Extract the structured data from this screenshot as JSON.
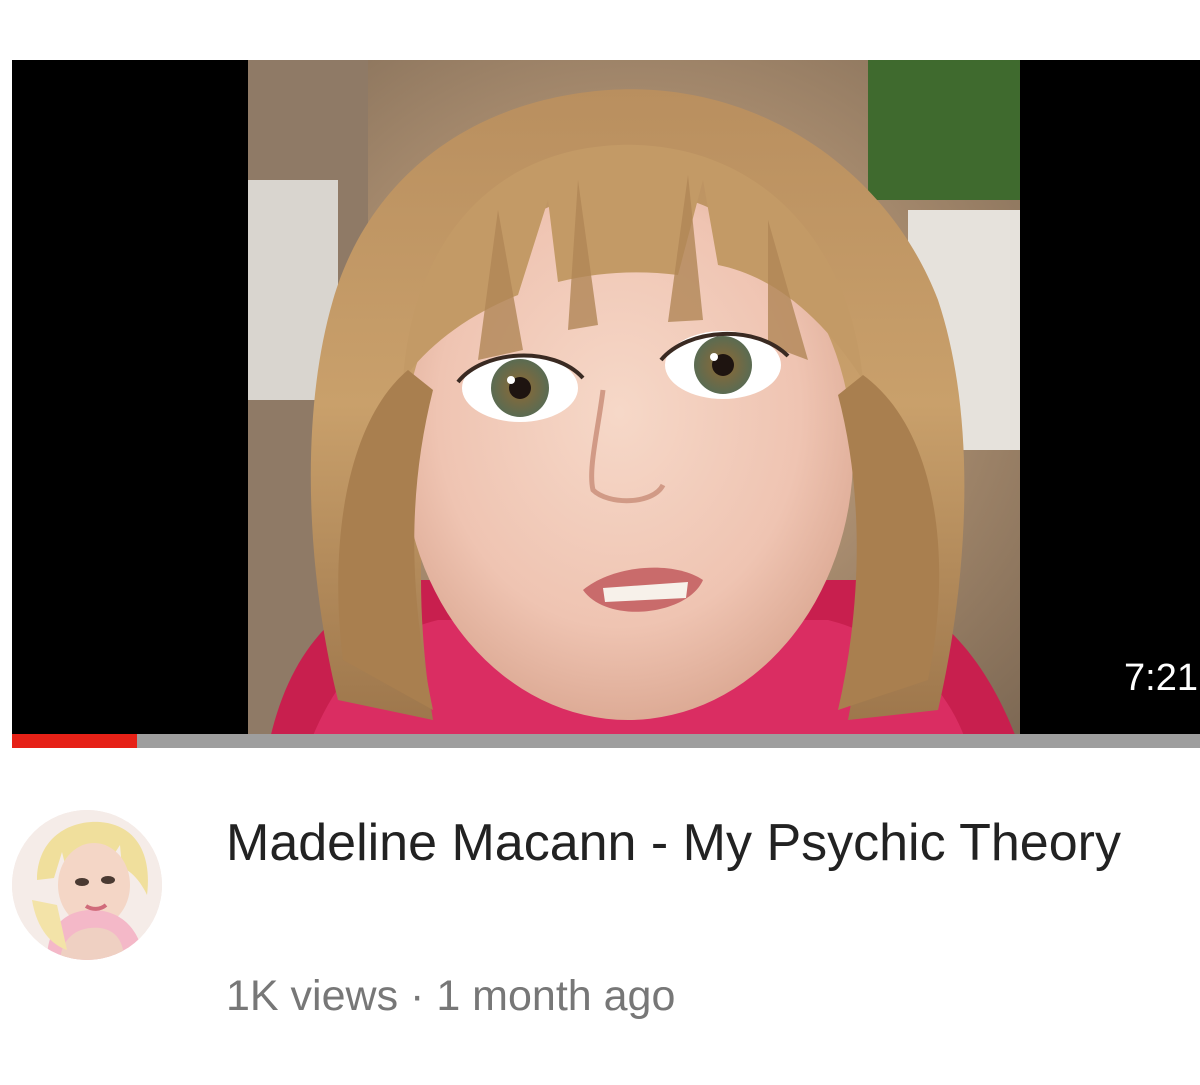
{
  "video": {
    "duration": "7:21",
    "watch_progress": 0.105,
    "thumbnail_icon": "thumbnail-image",
    "progress_color": "#e62117"
  },
  "channel": {
    "avatar_icon": "channel-avatar-image"
  },
  "details": {
    "title": "Madeline Macann - My Psychic Theory",
    "views": "1K views",
    "separator": "·",
    "age": "1 month ago"
  }
}
